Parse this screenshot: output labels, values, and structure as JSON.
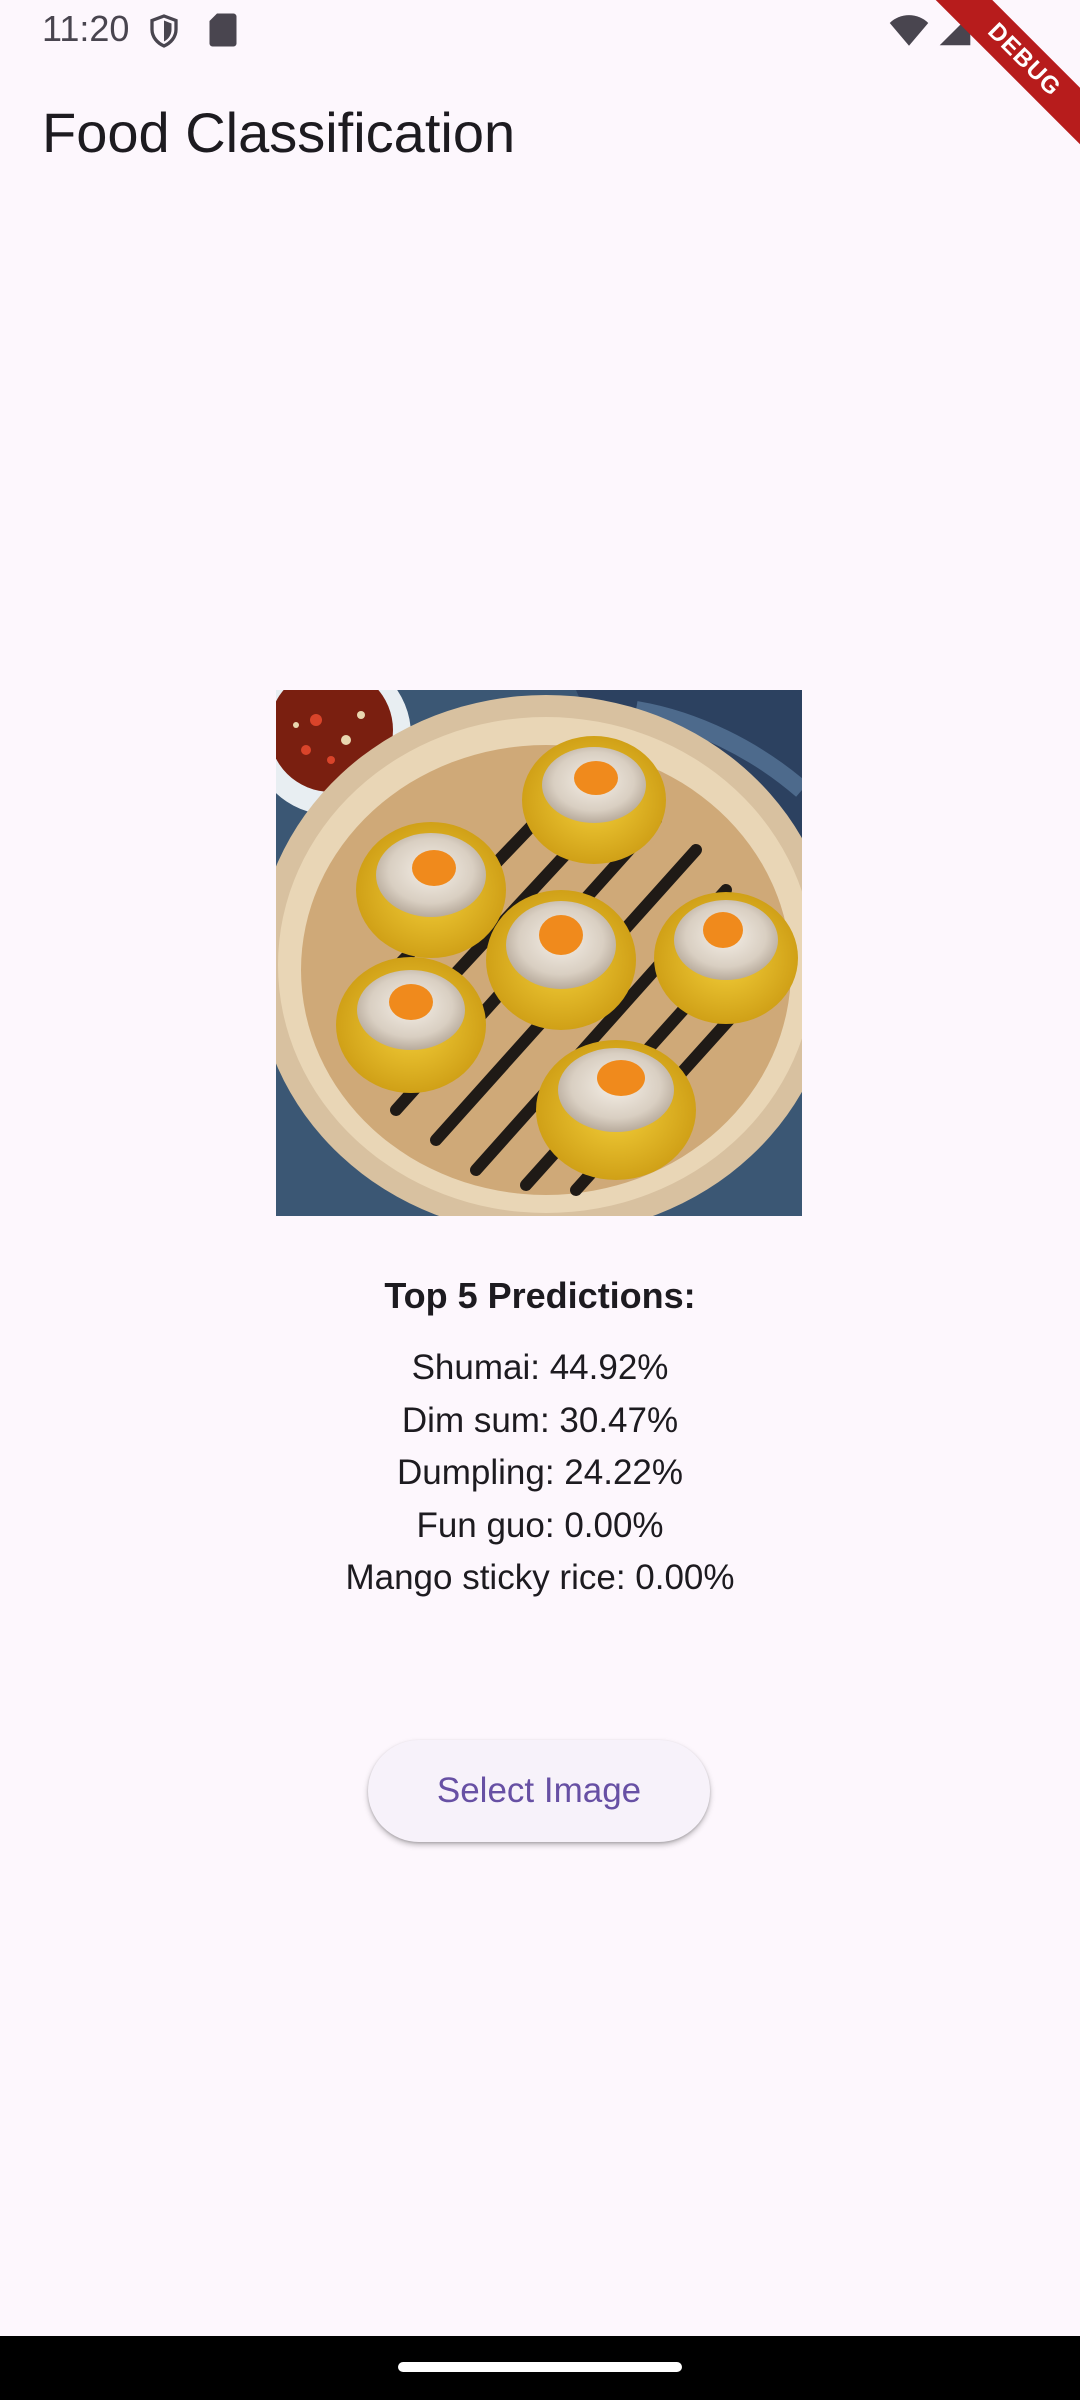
{
  "status_bar": {
    "time": "11:20",
    "icons": [
      "shield-icon",
      "sd-card-icon",
      "wifi-icon",
      "signal-icon",
      "battery-icon"
    ]
  },
  "debug_banner": {
    "label": "DEBUG",
    "color": "#b71c1c"
  },
  "app_bar": {
    "title": "Food Classification"
  },
  "image": {
    "subject": "shumai-in-bamboo-steamer"
  },
  "predictions": {
    "title": "Top 5 Predictions:",
    "items": [
      "Shumai: 44.92%",
      "Dim sum: 30.47%",
      "Dumpling: 24.22%",
      "Fun guo: 0.00%",
      "Mango sticky rice: 0.00%"
    ]
  },
  "actions": {
    "select_image_label": "Select Image"
  },
  "colors": {
    "background": "#fdf7fd",
    "accent": "#6750a4",
    "button_surface": "#f7f2fa",
    "text": "#1d1b20"
  }
}
